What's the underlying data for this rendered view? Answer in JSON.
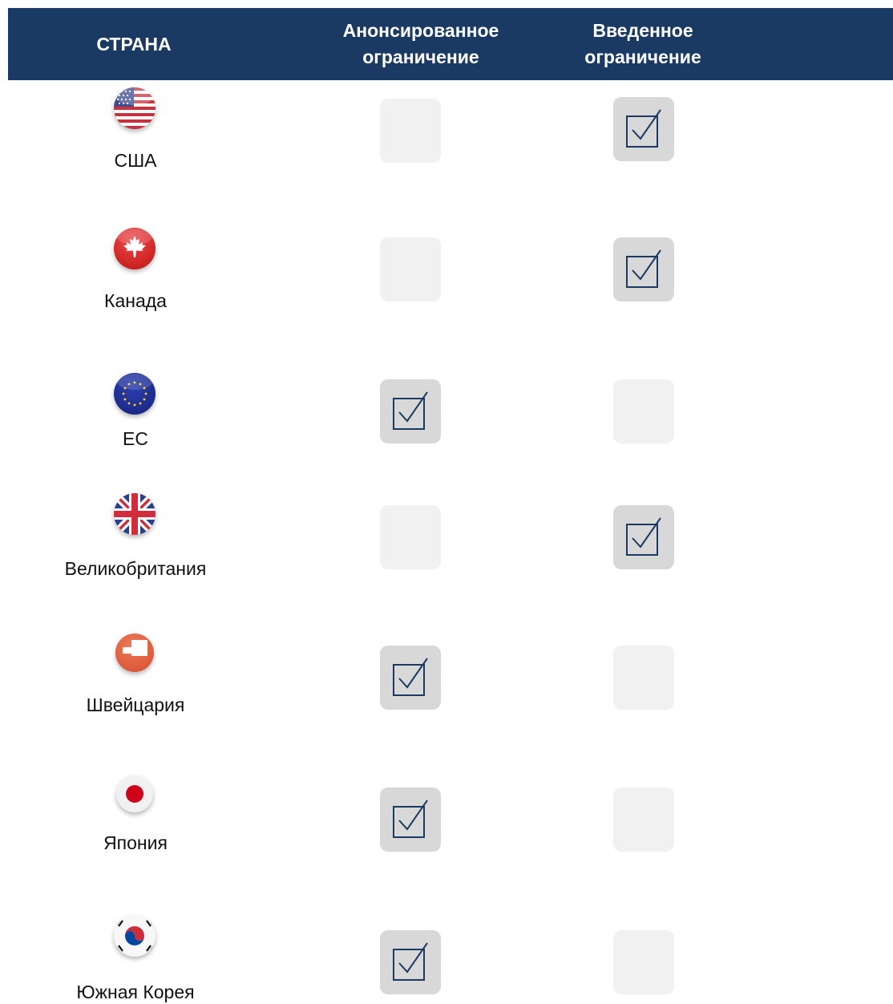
{
  "header": {
    "country": "СТРАНА",
    "announced": "Анонсированное\nограничение",
    "introduced": "Введенное\nограничение"
  },
  "colors": {
    "header_bg": "#1a3a63",
    "check_color": "#1a3a63",
    "checked_box": "#d8d8d8",
    "empty_box": "#f1f1f1"
  },
  "rows": [
    {
      "country": "США",
      "flag": "us-flag-icon",
      "announced": false,
      "introduced": true
    },
    {
      "country": "Канада",
      "flag": "canada-flag-icon",
      "announced": false,
      "introduced": true
    },
    {
      "country": "ЕС",
      "flag": "eu-flag-icon",
      "announced": true,
      "introduced": false
    },
    {
      "country": "Великобритания",
      "flag": "uk-flag-icon",
      "announced": false,
      "introduced": true
    },
    {
      "country": "Швейцария",
      "flag": "switzerland-flag-icon",
      "announced": true,
      "introduced": false
    },
    {
      "country": "Япония",
      "flag": "japan-flag-icon",
      "announced": true,
      "introduced": false
    },
    {
      "country": "Южная Корея",
      "flag": "south-korea-flag-icon",
      "announced": true,
      "introduced": false
    }
  ]
}
